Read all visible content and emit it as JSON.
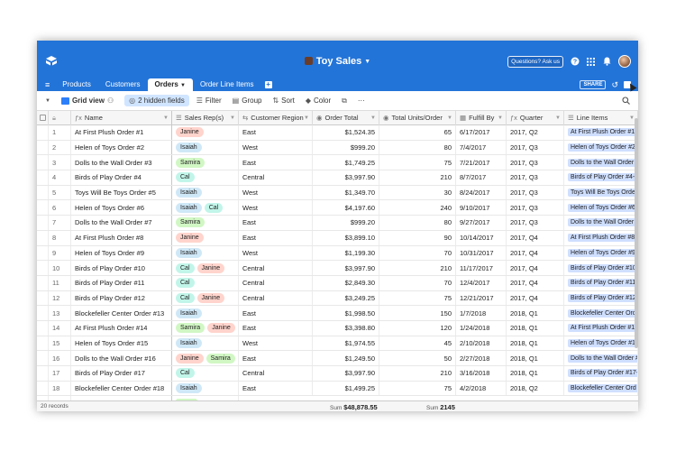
{
  "app": {
    "title": "Toy Sales",
    "ask_label": "Questions? Ask us"
  },
  "tabs": [
    {
      "label": "Products"
    },
    {
      "label": "Customers"
    },
    {
      "label": "Orders"
    },
    {
      "label": "Order Line Items"
    }
  ],
  "share_label": "SHARE",
  "toolbar": {
    "view_label": "Grid view",
    "hidden_fields_label": "2 hidden fields",
    "filter_label": "Filter",
    "group_label": "Group",
    "sort_label": "Sort",
    "color_label": "Color",
    "more_label": "···"
  },
  "columns": {
    "name": "Name",
    "reps": "Sales Rep(s)",
    "region": "Customer Region",
    "total": "Order Total",
    "units": "Total Units/Order",
    "fulfill": "Fulfill By",
    "quarter": "Quarter",
    "lines": "Line Items"
  },
  "rows": [
    {
      "num": "1",
      "name": "At First Plush Order #1",
      "reps": [
        "Janine"
      ],
      "region": "East",
      "total": "$1,524.35",
      "units": "65",
      "fulfill": "6/17/2017",
      "quarter": "2017, Q2",
      "lines": "At First Plush Order #1-"
    },
    {
      "num": "2",
      "name": "Helen of Toys Order #2",
      "reps": [
        "Isaiah"
      ],
      "region": "West",
      "total": "$999.20",
      "units": "80",
      "fulfill": "7/4/2017",
      "quarter": "2017, Q3",
      "lines": "Helen of Toys Order #2-"
    },
    {
      "num": "3",
      "name": "Dolls to the Wall Order #3",
      "reps": [
        "Samira"
      ],
      "region": "East",
      "total": "$1,749.25",
      "units": "75",
      "fulfill": "7/21/2017",
      "quarter": "2017, Q3",
      "lines": "Dolls to the Wall Order #"
    },
    {
      "num": "4",
      "name": "Birds of Play Order #4",
      "reps": [
        "Cal"
      ],
      "region": "Central",
      "total": "$3,997.90",
      "units": "210",
      "fulfill": "8/7/2017",
      "quarter": "2017, Q3",
      "lines": "Birds of Play Order #4-"
    },
    {
      "num": "5",
      "name": "Toys Will Be Toys Order #5",
      "reps": [
        "Isaiah"
      ],
      "region": "West",
      "total": "$1,349.70",
      "units": "30",
      "fulfill": "8/24/2017",
      "quarter": "2017, Q3",
      "lines": "Toys Will Be Toys Order"
    },
    {
      "num": "6",
      "name": "Helen of Toys Order #6",
      "reps": [
        "Isaiah",
        "Cal"
      ],
      "region": "West",
      "total": "$4,197.60",
      "units": "240",
      "fulfill": "9/10/2017",
      "quarter": "2017, Q3",
      "lines": "Helen of Toys Order #6-"
    },
    {
      "num": "7",
      "name": "Dolls to the Wall Order #7",
      "reps": [
        "Samira"
      ],
      "region": "East",
      "total": "$999.20",
      "units": "80",
      "fulfill": "9/27/2017",
      "quarter": "2017, Q3",
      "lines": "Dolls to the Wall Order #"
    },
    {
      "num": "8",
      "name": "At First Plush Order #8",
      "reps": [
        "Janine"
      ],
      "region": "East",
      "total": "$3,899.10",
      "units": "90",
      "fulfill": "10/14/2017",
      "quarter": "2017, Q4",
      "lines": "At First Plush Order #8-"
    },
    {
      "num": "9",
      "name": "Helen of Toys Order #9",
      "reps": [
        "Isaiah"
      ],
      "region": "West",
      "total": "$1,199.30",
      "units": "70",
      "fulfill": "10/31/2017",
      "quarter": "2017, Q4",
      "lines": "Helen of Toys Order #9-"
    },
    {
      "num": "10",
      "name": "Birds of Play Order #10",
      "reps": [
        "Cal",
        "Janine"
      ],
      "region": "Central",
      "total": "$3,997.90",
      "units": "210",
      "fulfill": "11/17/2017",
      "quarter": "2017, Q4",
      "lines": "Birds of Play Order #10-"
    },
    {
      "num": "11",
      "name": "Birds of Play Order #11",
      "reps": [
        "Cal"
      ],
      "region": "Central",
      "total": "$2,849.30",
      "units": "70",
      "fulfill": "12/4/2017",
      "quarter": "2017, Q4",
      "lines": "Birds of Play Order #11-"
    },
    {
      "num": "12",
      "name": "Birds of Play Order #12",
      "reps": [
        "Cal",
        "Janine"
      ],
      "region": "Central",
      "total": "$3,249.25",
      "units": "75",
      "fulfill": "12/21/2017",
      "quarter": "2017, Q4",
      "lines": "Birds of Play Order #12-"
    },
    {
      "num": "13",
      "name": "Blockefeller Center Order #13",
      "reps": [
        "Isaiah"
      ],
      "region": "East",
      "total": "$1,998.50",
      "units": "150",
      "fulfill": "1/7/2018",
      "quarter": "2018, Q1",
      "lines": "Blockefeller Center Ord"
    },
    {
      "num": "14",
      "name": "At First Plush Order #14",
      "reps": [
        "Samira",
        "Janine"
      ],
      "region": "East",
      "total": "$3,398.80",
      "units": "120",
      "fulfill": "1/24/2018",
      "quarter": "2018, Q1",
      "lines": "At First Plush Order #14"
    },
    {
      "num": "15",
      "name": "Helen of Toys Order #15",
      "reps": [
        "Isaiah"
      ],
      "region": "West",
      "total": "$1,974.55",
      "units": "45",
      "fulfill": "2/10/2018",
      "quarter": "2018, Q1",
      "lines": "Helen of Toys Order #15"
    },
    {
      "num": "16",
      "name": "Dolls to the Wall Order #16",
      "reps": [
        "Janine",
        "Samira"
      ],
      "region": "East",
      "total": "$1,249.50",
      "units": "50",
      "fulfill": "2/27/2018",
      "quarter": "2018, Q1",
      "lines": "Dolls to the Wall Order #"
    },
    {
      "num": "17",
      "name": "Birds of Play Order #17",
      "reps": [
        "Cal"
      ],
      "region": "Central",
      "total": "$3,997.90",
      "units": "210",
      "fulfill": "3/16/2018",
      "quarter": "2018, Q1",
      "lines": "Birds of Play Order #17-"
    },
    {
      "num": "18",
      "name": "Blockefeller Center Order #18",
      "reps": [
        "Isaiah"
      ],
      "region": "East",
      "total": "$1,499.25",
      "units": "75",
      "fulfill": "4/2/2018",
      "quarter": "2018, Q2",
      "lines": "Blockefeller Center Ord"
    }
  ],
  "footer": {
    "count": "20 records",
    "sum_label": "Sum",
    "sum_total": "$48,878.55",
    "sum_units": "2145"
  },
  "colors": {
    "topbar": "#2374d8",
    "Janine": "#ffd4cc",
    "Isaiah": "#cfe8f7",
    "Samira": "#d1f7c4",
    "Cal": "#c2f5e9",
    "line_chip": "#cfdfff"
  }
}
